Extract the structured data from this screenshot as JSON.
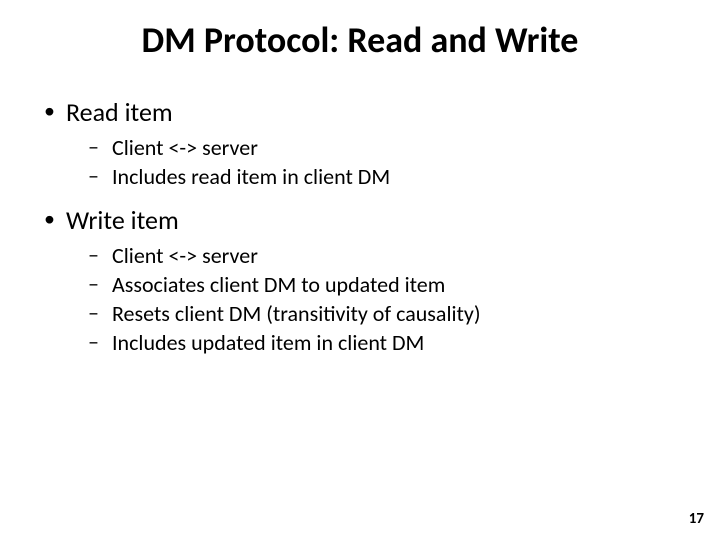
{
  "title": "DM Protocol: Read and Write",
  "bullets": [
    {
      "label": "Read item",
      "sub": [
        "Client <-> server",
        "Includes read item in client DM"
      ]
    },
    {
      "label": "Write item",
      "sub": [
        "Client <-> server",
        "Associates client DM to updated item",
        "Resets client DM (transitivity of causality)",
        "Includes updated item in client DM"
      ]
    }
  ],
  "page_number": "17"
}
